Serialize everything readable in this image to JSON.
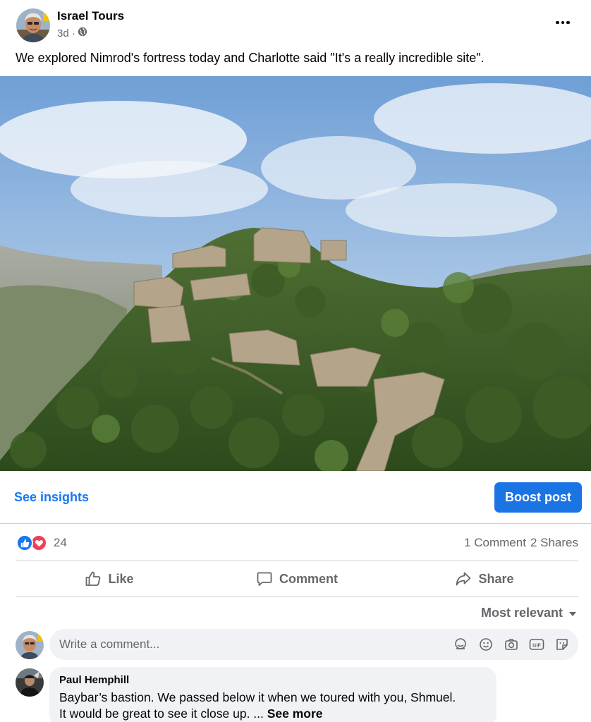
{
  "post": {
    "author": "Israel Tours",
    "time": "3d ·",
    "text": "We explored Nimrod's fortress today and Charlotte said \"It's a really incredible site\"."
  },
  "insights": {
    "see_insights": "See insights",
    "boost_post": "Boost post"
  },
  "engagement": {
    "reaction_count": "24",
    "comments": "1 Comment",
    "shares": "2 Shares"
  },
  "actions": {
    "like": "Like",
    "comment": "Comment",
    "share": "Share"
  },
  "comments_section": {
    "sort": "Most relevant",
    "input_placeholder": "Write a comment...",
    "comments": [
      {
        "name": "Paul Hemphill",
        "text_line1": "Baybar’s bastion. We passed below it when we toured with you, Shmuel.",
        "text_line2": "It would be great to see it close up. ... ",
        "see_more": "See more"
      }
    ]
  },
  "icons": {
    "privacy": "globe-icon",
    "more": "more-horizontal-icon",
    "like_reaction": "like-reaction-icon",
    "love_reaction": "love-reaction-icon",
    "like_action": "thumbs-up-icon",
    "comment_action": "comment-icon",
    "share_action": "share-icon",
    "sort": "caret-down-icon",
    "input_icons": [
      "avatar-sticker-icon",
      "emoji-icon",
      "camera-icon",
      "gif-icon",
      "sticker-icon"
    ]
  },
  "colors": {
    "brand_blue": "#1877f2",
    "boost_button": "#1b74e4",
    "love_red": "#f33e58",
    "secondary_text": "#65676b",
    "input_background": "#f0f2f5"
  }
}
